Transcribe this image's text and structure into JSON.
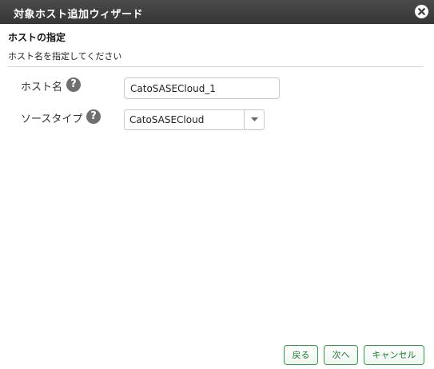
{
  "window": {
    "title": "対象ホスト追加ウィザード",
    "close_icon": "close-circle-icon"
  },
  "section": {
    "title": "ホストの指定",
    "description": "ホスト名を指定してください"
  },
  "form": {
    "host_name": {
      "label": "ホスト名",
      "value": "CatoSASECloud_1",
      "help_icon": "question-circle-icon",
      "help_glyph": "?"
    },
    "source_type": {
      "label": "ソースタイプ",
      "selected": "CatoSASECloud",
      "help_icon": "question-circle-icon",
      "help_glyph": "?"
    }
  },
  "buttons": {
    "back": "戻る",
    "next": "次へ",
    "cancel": "キャンセル"
  },
  "colors": {
    "titlebar": "#3d3d3d",
    "button_accent": "#2e9e4a",
    "help_icon": "#6f6f6f"
  }
}
